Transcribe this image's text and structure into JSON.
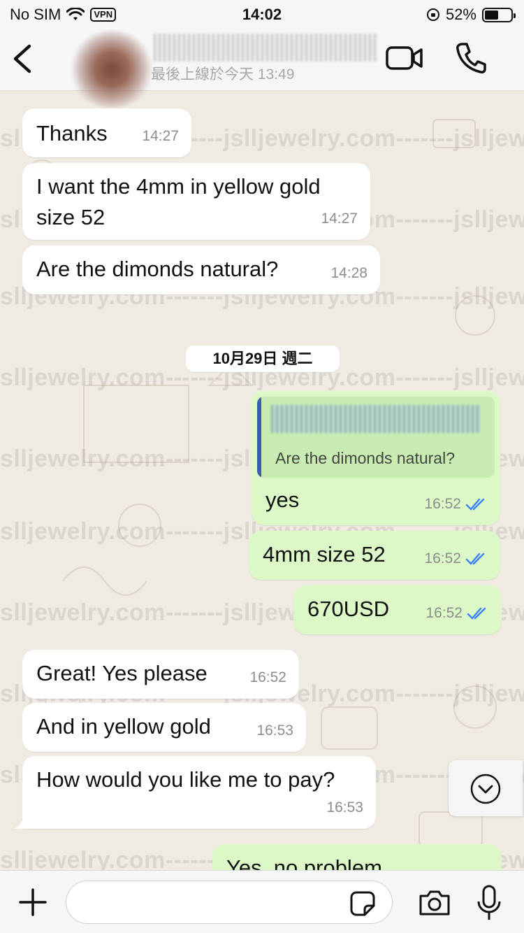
{
  "status_bar": {
    "carrier": "No SIM",
    "vpn": "VPN",
    "time": "14:02",
    "battery": "52%",
    "battery_level": 0.52
  },
  "header": {
    "last_seen": "最後上線於今天 13:49"
  },
  "watermark": "jslljewelry.com-------jslljewelry.com-------jslljewelry.com",
  "messages": [
    {
      "dir": "in",
      "text": "Thanks",
      "time": "14:27"
    },
    {
      "dir": "in",
      "text": "I want the 4mm in yellow gold size 52",
      "time": "14:27"
    },
    {
      "dir": "in",
      "text": "Are the dimonds natural?",
      "time": "14:28"
    },
    {
      "dir": "out",
      "text": "yes",
      "time": "16:52",
      "reply_quote": "Are the dimonds natural?"
    },
    {
      "dir": "out",
      "text": "4mm size 52",
      "time": "16:52"
    },
    {
      "dir": "out",
      "text": "670USD",
      "time": "16:52"
    },
    {
      "dir": "in",
      "text": "Great! Yes please",
      "time": "16:52"
    },
    {
      "dir": "in",
      "text": "And in yellow gold",
      "time": "16:53"
    },
    {
      "dir": "in",
      "text": "How would you like me to pay?",
      "time": "16:53"
    },
    {
      "dir": "out",
      "text": "Yes, no problem",
      "time": ""
    }
  ],
  "date_separator": "10月29日 週二",
  "composer": {
    "placeholder": ""
  },
  "icons": [
    "back-icon",
    "video-call-icon",
    "phone-icon",
    "double-check-icon",
    "scroll-down-icon",
    "plus-icon",
    "sticker-icon",
    "camera-icon",
    "microphone-icon"
  ],
  "colors": {
    "incoming": "#ffffff",
    "outgoing": "#dbf8c6",
    "read_tick": "#3b82f6"
  }
}
